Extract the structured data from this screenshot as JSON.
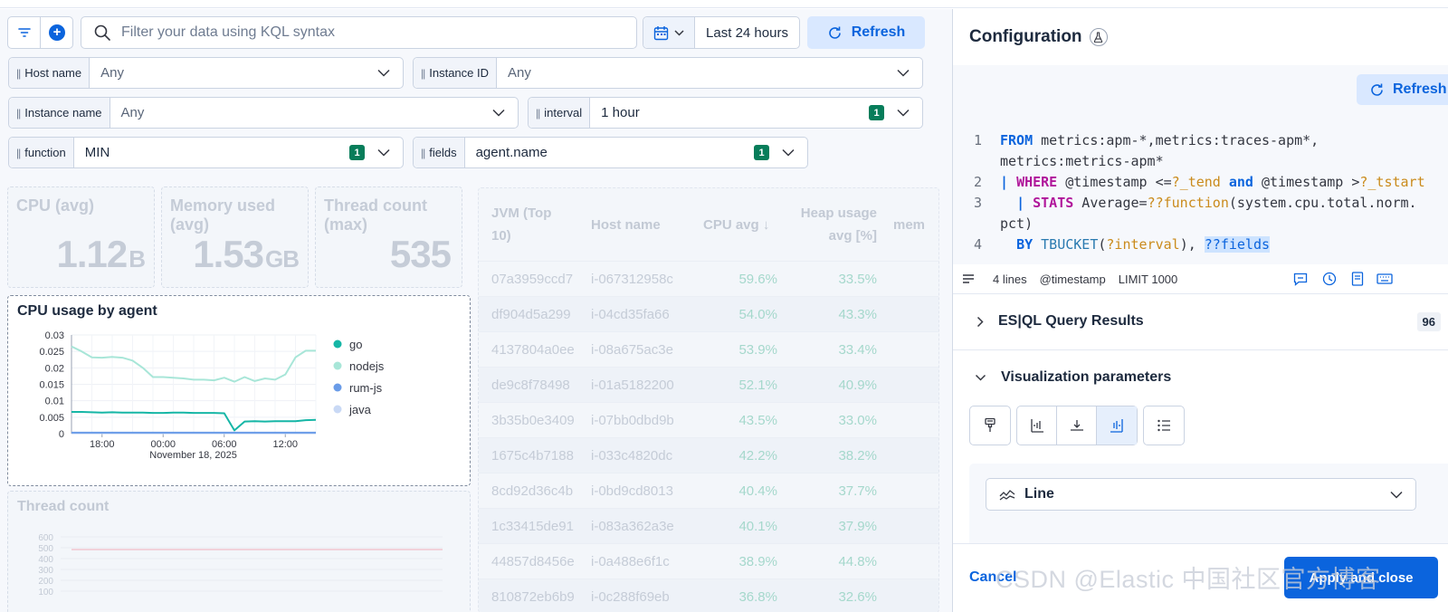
{
  "query_bar": {
    "search_placeholder": "Filter your data using KQL syntax",
    "time_range": "Last 24 hours",
    "refresh_label": "Refresh"
  },
  "controls": [
    {
      "label": "Host name",
      "value": "Any",
      "badge": ""
    },
    {
      "label": "Instance ID",
      "value": "Any",
      "badge": ""
    },
    {
      "label": "Instance name",
      "value": "Any",
      "badge": ""
    },
    {
      "label": "interval",
      "value": "1 hour",
      "badge": "1"
    },
    {
      "label": "function",
      "value": "MIN",
      "badge": "1"
    },
    {
      "label": "fields",
      "value": "agent.name",
      "badge": "1"
    }
  ],
  "metrics": [
    {
      "title_l1": "CPU (avg)",
      "title_l2": "",
      "value": "1.12",
      "unit": "B"
    },
    {
      "title_l1": "Memory used",
      "title_l2": "(avg)",
      "value": "1.53",
      "unit": "GB"
    },
    {
      "title_l1": "Thread count",
      "title_l2": "(max)",
      "value": "535",
      "unit": ""
    }
  ],
  "jvm_table": {
    "headers": {
      "jvm_l1": "JVM (Top",
      "jvm_l2": "10)",
      "host": "Host name",
      "cpu": "CPU avg ↓",
      "heap_l1": "Heap usage",
      "heap_l2": "avg [%]",
      "mem": "mem"
    },
    "rows": [
      {
        "jvm": "07a3959ccd7",
        "host": "i-067312958c",
        "cpu": "59.6%",
        "heap": "33.5%"
      },
      {
        "jvm": "df904d5a299",
        "host": "i-04cd35fa66",
        "cpu": "54.0%",
        "heap": "43.3%"
      },
      {
        "jvm": "4137804a0ee",
        "host": "i-08a675ac3e",
        "cpu": "53.9%",
        "heap": "33.4%"
      },
      {
        "jvm": "de9c8f78498",
        "host": "i-01a5182200",
        "cpu": "52.1%",
        "heap": "40.9%"
      },
      {
        "jvm": "3b35b0e3409",
        "host": "i-07bb0dbd9b",
        "cpu": "43.5%",
        "heap": "33.0%"
      },
      {
        "jvm": "1675c4b7188",
        "host": "i-033c4820dc",
        "cpu": "42.2%",
        "heap": "38.2%"
      },
      {
        "jvm": "8cd92d36c4b",
        "host": "i-0bd9cd8013",
        "cpu": "40.4%",
        "heap": "37.7%"
      },
      {
        "jvm": "1c33415de91",
        "host": "i-083a362a3e",
        "cpu": "40.1%",
        "heap": "37.9%"
      },
      {
        "jvm": "44857d8456e",
        "host": "i-0a488e6f1c",
        "cpu": "38.9%",
        "heap": "44.8%"
      },
      {
        "jvm": "810872eb6b9",
        "host": "i-0c288f69eb",
        "cpu": "36.8%",
        "heap": "32.6%"
      }
    ]
  },
  "cpu_chart": {
    "title": "CPU usage by agent",
    "chart_data": {
      "type": "line",
      "x": [
        "15:00",
        "16:00",
        "17:00",
        "18:00",
        "19:00",
        "20:00",
        "21:00",
        "22:00",
        "23:00",
        "00:00",
        "01:00",
        "02:00",
        "03:00",
        "04:00",
        "05:00",
        "06:00",
        "07:00",
        "08:00",
        "09:00",
        "10:00",
        "11:00",
        "12:00",
        "13:00",
        "14:00",
        "15:00"
      ],
      "x_ticks": [
        "18:00",
        "00:00",
        "06:00",
        "12:00"
      ],
      "x_sublabel": "November 18, 2025",
      "yticks": [
        "0.03",
        "0.025",
        "0.02",
        "0.015",
        "0.01",
        "0.005",
        "0"
      ],
      "ylim": [
        0,
        0.03
      ],
      "series": [
        {
          "name": "go",
          "color": "#16b6a6",
          "values": [
            0.0066,
            0.0066,
            0.0065,
            0.0064,
            0.0065,
            0.0064,
            0.0064,
            0.0064,
            0.0063,
            0.0063,
            0.0064,
            0.0064,
            0.0063,
            0.0063,
            0.0063,
            0.0062,
            0.001,
            0.0037,
            0.0038,
            0.0037,
            0.0038,
            0.0038,
            0.0038,
            0.0041,
            0.0042
          ]
        },
        {
          "name": "nodejs",
          "color": "#a8e6d8",
          "values": [
            0.0265,
            0.025,
            0.0232,
            0.0231,
            0.0233,
            0.0231,
            0.0222,
            0.02,
            0.0172,
            0.0172,
            0.017,
            0.0168,
            0.0164,
            0.0164,
            0.0162,
            0.017,
            0.0158,
            0.0172,
            0.016,
            0.0168,
            0.0164,
            0.018,
            0.0232,
            0.0252,
            0.0252
          ]
        },
        {
          "name": "rum-js",
          "color": "#6a9ce8",
          "values": [
            0.0003,
            0.0003,
            0.0003,
            0.0003,
            0.0003,
            0.0003,
            0.0003,
            0.0003,
            0.0003,
            0.0003,
            0.0003,
            0.0003,
            0.0003,
            0.0003,
            0.0003,
            0.0003,
            0.0003,
            0.0003,
            0.0003,
            0.0003,
            0.0003,
            0.0003,
            0.0003,
            0.0003,
            0.0003
          ]
        },
        {
          "name": "java",
          "color": "#c9d9f5",
          "values": [
            0.0001,
            0.0001,
            0.0001,
            0.0001,
            0.0001,
            0.0001,
            0.0001,
            0.0001,
            0.0001,
            0.0001,
            0.0001,
            0.0001,
            0.0001,
            0.0001,
            0.0001,
            0.0001,
            0.0001,
            0.0001,
            0.0001,
            0.0001,
            0.0001,
            0.0001,
            0.0001,
            0.0001,
            0.0001
          ]
        }
      ]
    }
  },
  "thread_chart": {
    "title": "Thread count",
    "yticks": [
      "600",
      "500",
      "400",
      "300",
      "200",
      "100"
    ]
  },
  "config": {
    "title": "Configuration",
    "refresh_label": "Refresh",
    "line_numbers": [
      "1",
      "",
      "2",
      "3",
      "",
      "4"
    ],
    "query_lines": [
      "FROM metrics:apm-*,metrics:traces-apm*,",
      "metrics:metrics-apm*",
      "| WHERE @timestamp <=?_tend and @timestamp >?_tstart",
      "  | STATS Average=??function(system.cpu.total.norm.",
      "pct)",
      "  BY TBUCKET(?interval), ??fields"
    ],
    "footer": {
      "lines": "4 lines",
      "timestamp": "@timestamp",
      "limit": "LIMIT 1000"
    },
    "results_label": "ES|QL Query Results",
    "results_count": "96",
    "viz_label": "Visualization parameters",
    "chart_type": "Line",
    "cancel_label": "Cancel",
    "apply_label": "Apply and close"
  },
  "watermark": "CSDN @Elastic 中国社区官方博客"
}
